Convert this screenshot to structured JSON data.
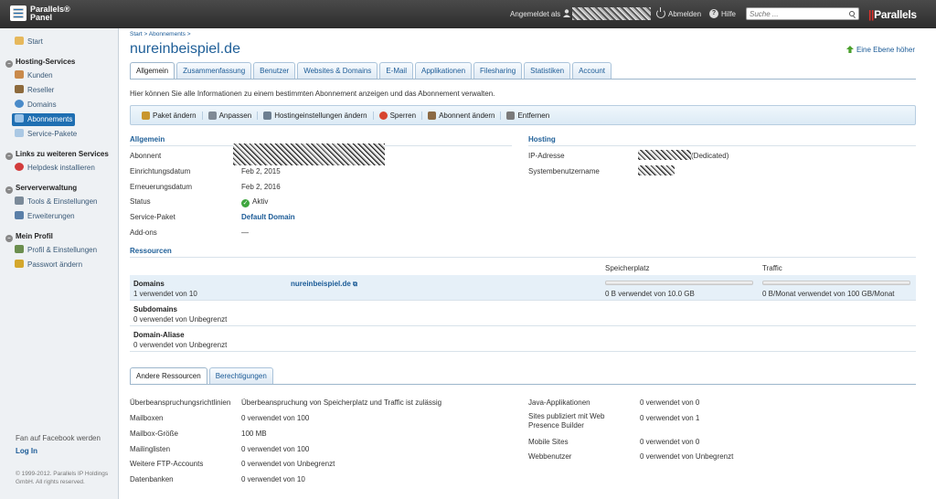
{
  "header": {
    "logo_line1": "Parallels®",
    "logo_line2": "Panel",
    "logged_in_label": "Angemeldet als",
    "logout": "Abmelden",
    "help": "Hilfe",
    "search_placeholder": "Suche ...",
    "brand": "Parallels"
  },
  "sidebar": {
    "start": "Start",
    "hosting_title": "Hosting-Services",
    "hosting_items": [
      "Kunden",
      "Reseller",
      "Domains",
      "Abonnements",
      "Service-Pakete"
    ],
    "links_title": "Links zu weiteren Services",
    "links_items": [
      "Helpdesk installieren"
    ],
    "server_title": "Serververwaltung",
    "server_items": [
      "Tools & Einstellungen",
      "Erweiterungen"
    ],
    "profile_title": "Mein Profil",
    "profile_items": [
      "Profil & Einstellungen",
      "Passwort ändern"
    ],
    "facebook": "Fan auf Facebook werden",
    "login": "Log In",
    "copyright": "© 1999-2012. Parallels IP Holdings GmbH. All rights reserved."
  },
  "breadcrumb": "Start > Abonnements >",
  "page_title": "nureinbeispiel.de",
  "up_link": "Eine Ebene höher",
  "tabs": [
    "Allgemein",
    "Zusammenfassung",
    "Benutzer",
    "Websites & Domains",
    "E-Mail",
    "Applikationen",
    "Filesharing",
    "Statistiken",
    "Account"
  ],
  "intro": "Hier können Sie alle Informationen zu einem bestimmten Abonnement anzeigen und das Abonnement verwalten.",
  "toolbar": [
    "Paket ändern",
    "Anpassen",
    "Hostingeinstellungen ändern",
    "Sperren",
    "Abonnent ändern",
    "Entfernen"
  ],
  "general": {
    "title": "Allgemein",
    "labels": [
      "Abonnent",
      "Einrichtungsdatum",
      "Erneuerungsdatum",
      "Status",
      "Service-Paket",
      "Add-ons"
    ],
    "setup_date": "Feb 2, 2015",
    "renewal_date": "Feb 2, 2016",
    "status": "Aktiv",
    "service_package": "Default Domain",
    "addons": "—"
  },
  "hosting": {
    "title": "Hosting",
    "ip_label": "IP-Adresse",
    "ip_suffix": "(Dedicated)",
    "user_label": "Systembenutzername"
  },
  "resources": {
    "title": "Ressourcen",
    "col_storage": "Speicherplatz",
    "col_traffic": "Traffic",
    "domains_name": "Domains",
    "domains_sub": "1 verwendet von 10",
    "domain_link": "nureinbeispiel.de",
    "storage_text": "0 B verwendet von 10.0 GB",
    "traffic_text": "0 B/Monat verwendet von 100 GB/Monat",
    "storage_fraction": 0,
    "traffic_fraction": 0,
    "subdomains_name": "Subdomains",
    "subdomains_sub": "0 verwendet von Unbegrenzt",
    "alias_name": "Domain-Aliase",
    "alias_sub": "0 verwendet von Unbegrenzt"
  },
  "lower_tabs": [
    "Andere Ressourcen",
    "Berechtigungen"
  ],
  "other_left": [
    {
      "label": "Überbeanspruchungsrichtlinien",
      "value": "Überbeanspruchung von Speicherplatz und Traffic ist zulässig"
    },
    {
      "label": "Mailboxen",
      "value": "0 verwendet von 100"
    },
    {
      "label": "Mailbox-Größe",
      "value": "100 MB"
    },
    {
      "label": "Mailinglisten",
      "value": "0 verwendet von 100"
    },
    {
      "label": "Weitere FTP-Accounts",
      "value": "0 verwendet von Unbegrenzt"
    },
    {
      "label": "Datenbanken",
      "value": "0 verwendet von 10"
    }
  ],
  "other_right": [
    {
      "label": "Java-Applikationen",
      "value": "0 verwendet von 0"
    },
    {
      "label_l1": "Sites publiziert mit Web",
      "label_l2": "Presence Builder",
      "value": "0 verwendet von 1"
    },
    {
      "label": "Mobile Sites",
      "value": "0 verwendet von 0"
    },
    {
      "label": "Webbenutzer",
      "value": "0 verwendet von Unbegrenzt"
    }
  ]
}
